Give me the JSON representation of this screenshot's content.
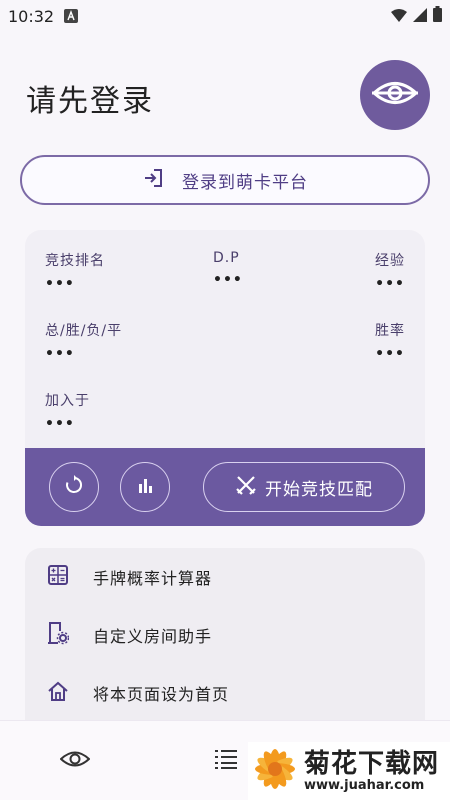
{
  "status_bar": {
    "time": "10:32",
    "notification_icon": "a-letter-icon",
    "wifi_icon": "wifi-icon",
    "signal_icon": "signal-icon",
    "battery_icon": "battery-icon"
  },
  "header": {
    "title": "请先登录",
    "eye_icon": "eye-icon"
  },
  "login": {
    "label": "登录到萌卡平台",
    "icon": "login-icon"
  },
  "stats": {
    "rank_label": "竞技排名",
    "rank_value": "•••",
    "dp_label": "D.P",
    "dp_value": "•••",
    "exp_label": "经验",
    "exp_value": "•••",
    "record_label": "总/胜/负/平",
    "record_value": "•••",
    "winrate_label": "胜率",
    "winrate_value": "•••",
    "joined_label": "加入于",
    "joined_value": "•••"
  },
  "actions": {
    "refresh_icon": "refresh-icon",
    "chart_icon": "bar-chart-icon",
    "match_label": "开始竞技匹配",
    "match_icon": "crossed-swords-icon"
  },
  "tools": [
    {
      "label": "手牌概率计算器",
      "icon": "calculator-icon"
    },
    {
      "label": "自定义房间助手",
      "icon": "room-settings-icon"
    },
    {
      "label": "将本页面设为首页",
      "icon": "home-icon"
    }
  ],
  "bottom_nav": {
    "eye_icon": "eye-icon",
    "list_icon": "list-icon"
  },
  "watermark": {
    "title": "菊花下载网",
    "url": "www.juahar.com"
  },
  "colors": {
    "accent": "#6b59a0",
    "accent_dark": "#4f3d85",
    "background": "#f8f6fa"
  }
}
